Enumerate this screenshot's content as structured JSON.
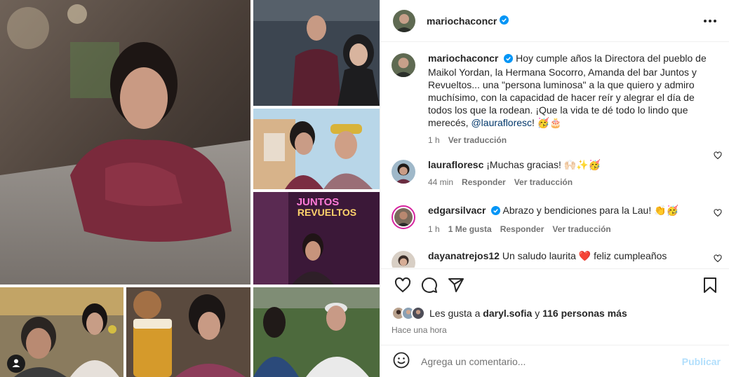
{
  "post": {
    "author": "mariochaconcr",
    "verified": true,
    "caption": "Hoy cumple años la Directora del pueblo de Maikol Yordan, la Hermana Socorro, Amanda del bar Juntos y Revueltos... una \"persona luminosa\" a la que quiero y admiro muchísimo, con la capacidad de hacer reír y alegrar el día de todos los que la rodean. ¡Que la vida te dé todo lo lindo que merecés,",
    "caption_mention": "@laurafloresc",
    "caption_end": "! 🥳🎂",
    "caption_time": "1 h",
    "caption_translate": "Ver traducción"
  },
  "media": {
    "sign_text": "JUNTOS REVUELTOS"
  },
  "comments": [
    {
      "user": "laurafloresc",
      "verified": false,
      "text": "¡Muchas gracias! 🙌🏻✨🥳",
      "time": "44 min",
      "reply": "Responder",
      "translate": "Ver traducción"
    },
    {
      "user": "edgarsilvacr",
      "verified": true,
      "text": "Abrazo y bendiciones para la Lau! 👏🥳",
      "time": "1 h",
      "likes": "1 Me gusta",
      "reply": "Responder",
      "translate": "Ver traducción"
    },
    {
      "user": "dayanatrejos12",
      "verified": false,
      "text": "Un saludo laurita ❤️ feliz cumpleaños"
    }
  ],
  "likes": {
    "prefix": "Les gusta a",
    "user": "daryl.sofia",
    "conj": "y",
    "others": "116 personas más"
  },
  "posted_ago": "Hace una hora",
  "add_comment": {
    "placeholder": "Agrega un comentario...",
    "publish": "Publicar"
  },
  "icons": {
    "like": "heart-icon",
    "comment": "comment-icon",
    "share": "share-icon",
    "save": "bookmark-icon",
    "emoji": "emoji-icon",
    "more": "more-options-icon",
    "tag": "user-tag-icon"
  },
  "colors": {
    "verified": "#0095f6",
    "link": "#00376b",
    "muted": "#737373",
    "publish_disabled": "#b2dffc"
  }
}
